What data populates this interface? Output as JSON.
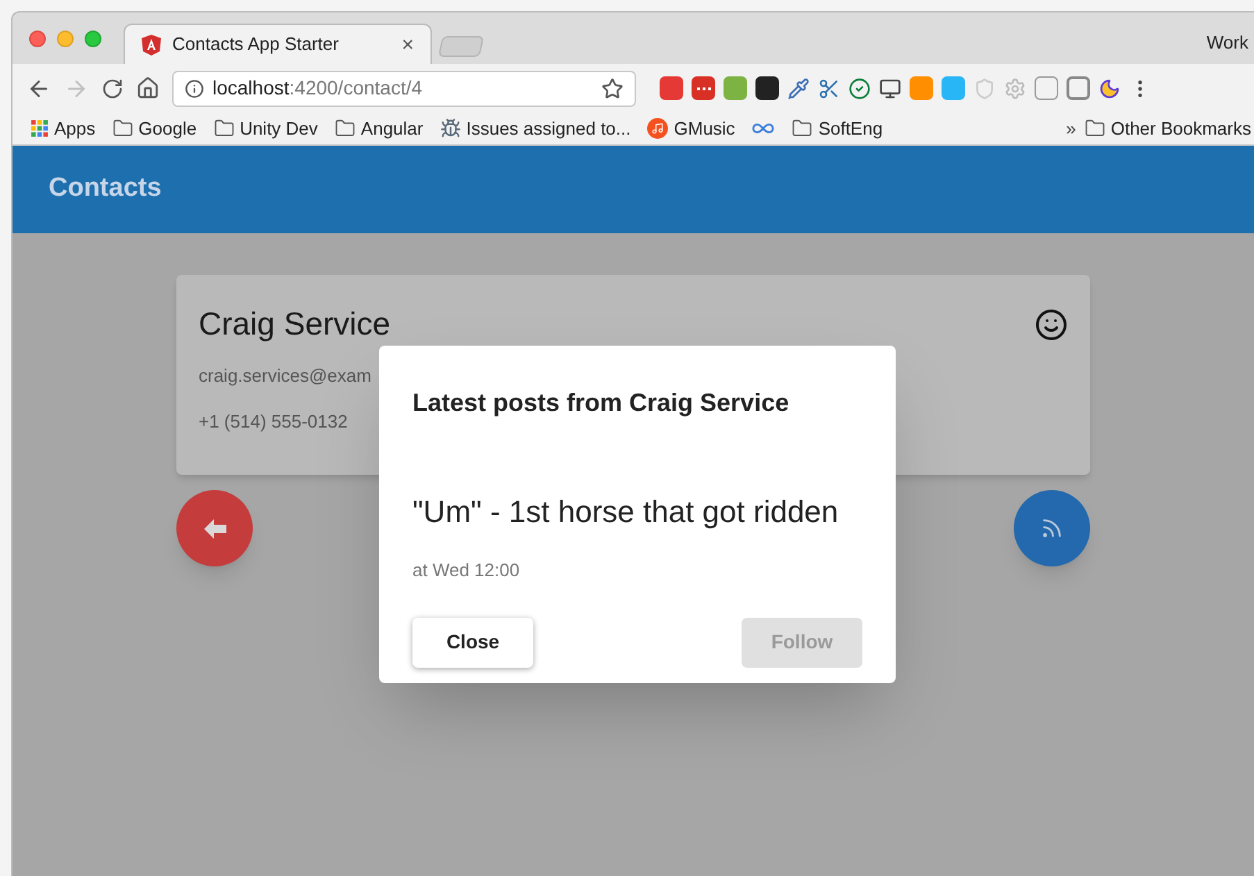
{
  "browser": {
    "tab": {
      "title": "Contacts App Starter",
      "close": "×"
    },
    "profile": "Work",
    "address": {
      "host": "localhost",
      "path": ":4200/contact/4"
    },
    "bookmarks": [
      {
        "kind": "apps",
        "label": "Apps"
      },
      {
        "kind": "folder",
        "label": "Google"
      },
      {
        "kind": "folder",
        "label": "Unity Dev"
      },
      {
        "kind": "folder",
        "label": "Angular"
      },
      {
        "kind": "bug",
        "label": "Issues assigned to..."
      },
      {
        "kind": "music",
        "label": "GMusic"
      },
      {
        "kind": "infinity"
      },
      {
        "kind": "folder",
        "label": "SoftEng"
      }
    ],
    "more_bookmarks": "»",
    "other_bookmarks": "Other Bookmarks"
  },
  "app": {
    "title": "Contacts"
  },
  "contact": {
    "name": "Craig Service",
    "email": "craig.services@exam",
    "phone": "+1 (514) 555-0132"
  },
  "dialog": {
    "title": "Latest posts from Craig Service",
    "post": "\"Um\" - 1st horse that got ridden",
    "time": "at Wed 12:00",
    "buttons": [
      {
        "label": "Close",
        "disabled": false
      },
      {
        "label": "Follow",
        "disabled": true
      }
    ]
  }
}
